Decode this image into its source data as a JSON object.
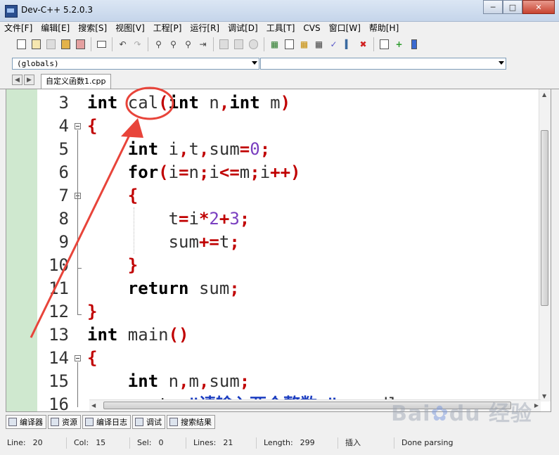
{
  "window": {
    "title": "Dev-C++ 5.2.0.3"
  },
  "menu": [
    "文件[F]",
    "编辑[E]",
    "搜索[S]",
    "视图[V]",
    "工程[P]",
    "运行[R]",
    "调试[D]",
    "工具[T]",
    "CVS",
    "窗口[W]",
    "帮助[H]"
  ],
  "classbar": {
    "scope": "(globals)",
    "member": ""
  },
  "tab": {
    "filename": "自定义函数1.cpp"
  },
  "editor": {
    "lines": [
      {
        "n": "3",
        "fold": ""
      },
      {
        "n": "4",
        "fold": "open"
      },
      {
        "n": "5",
        "fold": ""
      },
      {
        "n": "6",
        "fold": ""
      },
      {
        "n": "7",
        "fold": "open"
      },
      {
        "n": "8",
        "fold": ""
      },
      {
        "n": "9",
        "fold": ""
      },
      {
        "n": "10",
        "fold": "end"
      },
      {
        "n": "11",
        "fold": ""
      },
      {
        "n": "12",
        "fold": "end"
      },
      {
        "n": "13",
        "fold": ""
      },
      {
        "n": "14",
        "fold": "open"
      },
      {
        "n": "15",
        "fold": ""
      },
      {
        "n": "16",
        "fold": ""
      }
    ],
    "code": [
      [
        [
          "kw",
          "int"
        ],
        [
          "t",
          " cal"
        ],
        [
          "op",
          "("
        ],
        [
          "kw",
          "int"
        ],
        [
          "t",
          " n"
        ],
        [
          "op",
          ","
        ],
        [
          "kw",
          "int"
        ],
        [
          "t",
          " m"
        ],
        [
          "op",
          ")"
        ]
      ],
      [
        [
          "op",
          "{"
        ]
      ],
      [
        [
          "t",
          "    "
        ],
        [
          "kw",
          "int"
        ],
        [
          "t",
          " i"
        ],
        [
          "op",
          ","
        ],
        [
          "t",
          "t"
        ],
        [
          "op",
          ","
        ],
        [
          "t",
          "sum"
        ],
        [
          "op",
          "="
        ],
        [
          "num",
          "0"
        ],
        [
          "op",
          ";"
        ]
      ],
      [
        [
          "t",
          "    "
        ],
        [
          "kw",
          "for"
        ],
        [
          "op",
          "("
        ],
        [
          "t",
          "i"
        ],
        [
          "op",
          "="
        ],
        [
          "t",
          "n"
        ],
        [
          "op",
          ";"
        ],
        [
          "t",
          "i"
        ],
        [
          "op",
          "<="
        ],
        [
          "t",
          "m"
        ],
        [
          "op",
          ";"
        ],
        [
          "t",
          "i"
        ],
        [
          "op",
          "++)"
        ]
      ],
      [
        [
          "t",
          "    "
        ],
        [
          "op",
          "{"
        ]
      ],
      [
        [
          "t",
          "        t"
        ],
        [
          "op",
          "="
        ],
        [
          "t",
          "i"
        ],
        [
          "op",
          "*"
        ],
        [
          "num",
          "2"
        ],
        [
          "op",
          "+"
        ],
        [
          "num",
          "3"
        ],
        [
          "op",
          ";"
        ]
      ],
      [
        [
          "t",
          "        sum"
        ],
        [
          "op",
          "+="
        ],
        [
          "t",
          "t"
        ],
        [
          "op",
          ";"
        ]
      ],
      [
        [
          "t",
          "    "
        ],
        [
          "op",
          "}"
        ]
      ],
      [
        [
          "t",
          "    "
        ],
        [
          "kw",
          "return"
        ],
        [
          "t",
          " sum"
        ],
        [
          "op",
          ";"
        ]
      ],
      [
        [
          "op",
          "}"
        ]
      ],
      [
        [
          "kw",
          "int"
        ],
        [
          "t",
          " main"
        ],
        [
          "op",
          "()"
        ]
      ],
      [
        [
          "op",
          "{"
        ]
      ],
      [
        [
          "t",
          "    "
        ],
        [
          "kw",
          "int"
        ],
        [
          "t",
          " n"
        ],
        [
          "op",
          ","
        ],
        [
          "t",
          "m"
        ],
        [
          "op",
          ","
        ],
        [
          "t",
          "sum"
        ],
        [
          "op",
          ";"
        ]
      ],
      [
        [
          "t",
          "    cout"
        ],
        [
          "op",
          "<<"
        ],
        [
          "str",
          "\"请输入两个整数:\""
        ],
        [
          "op",
          "<<"
        ],
        [
          "t",
          "endl"
        ],
        [
          "op",
          ";"
        ]
      ]
    ]
  },
  "bottom_tabs": [
    "编译器",
    "资源",
    "编译日志",
    "调试",
    "搜索结果"
  ],
  "status": {
    "line_label": "Line:",
    "line": "20",
    "col_label": "Col:",
    "col": "15",
    "sel_label": "Sel:",
    "sel": "0",
    "lines_label": "Lines:",
    "lines": "21",
    "length_label": "Length:",
    "length": "299",
    "mode": "插入",
    "message": "Done parsing"
  },
  "watermark": "Baidu 经验",
  "colors": {
    "keyword": "#000000",
    "operator": "#c00000",
    "number": "#7a3fc0",
    "gutter_margin": "#cfe8cf",
    "annotation": "#e8443a"
  }
}
